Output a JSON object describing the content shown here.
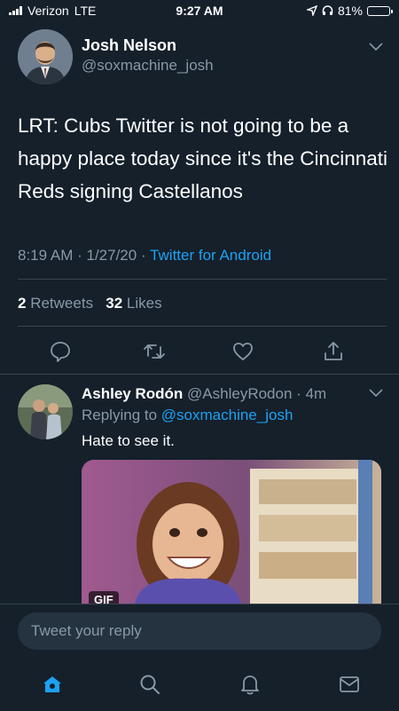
{
  "status_bar": {
    "carrier": "Verizon",
    "network": "LTE",
    "time": "9:27 AM",
    "battery_percent": "81%",
    "battery_level": 0.81
  },
  "main_tweet": {
    "author_name": "Josh Nelson",
    "author_handle": "@soxmachine_josh",
    "text": "LRT: Cubs Twitter is not going to be a happy place today since it's the Cincinnati Reds signing Castellanos",
    "time": "8:19 AM",
    "date": "1/27/20",
    "separator": "·",
    "client": "Twitter for Android",
    "retweets_count": "2",
    "retweets_label": "Retweets",
    "likes_count": "32",
    "likes_label": "Likes"
  },
  "reply": {
    "author_name": "Ashley Rodón",
    "author_handle": "@AshleyRodon",
    "separator": "·",
    "time": "4m",
    "replying_label": "Replying to",
    "replying_to": "@soxmachine_josh",
    "text": "Hate to see it.",
    "media_badge": "GIF"
  },
  "composer": {
    "placeholder": "Tweet your reply"
  },
  "tabbar": {
    "items": [
      "home-icon",
      "search-icon",
      "notifications-icon",
      "messages-icon"
    ],
    "active_color": "#1da1f2"
  },
  "colors": {
    "background": "#15202b",
    "secondary_text": "#8899a6",
    "accent": "#1da1f2",
    "divider": "#38444d"
  }
}
